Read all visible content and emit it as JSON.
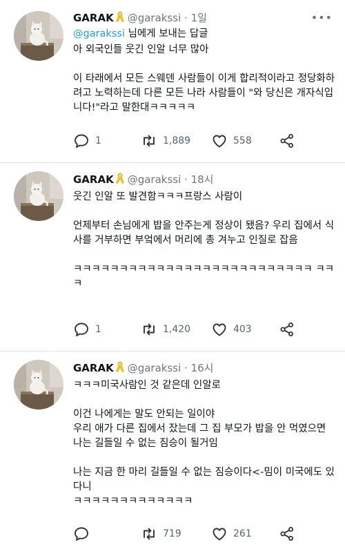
{
  "tweets": [
    {
      "name": "GARAK",
      "handle": "@garakssi",
      "time": "1일",
      "reply_to_handle": "@garakssi",
      "reply_to_suffix": " 님에게 보내는 답글",
      "paragraphs": [
        "아 외국인들 웃긴 인알 너무 많아",
        "",
        "이 타래에서 모든 스웨덴 사람들이 이게 합리적이라고 정당화하려고 노력하는데 다른 모든 나라 사람들이 \"와 당신은 개자식입니다!\"라고 말한대ㅋㅋㅋㅋㅋ"
      ],
      "replies": "1",
      "retweets": "1,889",
      "likes": "558",
      "more_icon": "more-dots-icon"
    },
    {
      "name": "GARAK",
      "handle": "@garakssi",
      "time": "18시",
      "paragraphs": [
        "웃긴 인알 또 발견함ㅋㅋㅋ프랑스 사람이",
        "",
        "언제부터 손님에게 밥을 안주는게 정상이 됐음? 우리 집에서 식사를 거부하면 부엌에서 머리에 총 겨누고 인질로 잡음",
        "",
        "ㅋㅋㅋㅋㅋㅋㅋㅋㅋㅋㅋㅋㅋㅋㅋㅋㅋㅋㅋㅋㅋㅋㅋㅋㅋㅋ ㅋㅋㅋ"
      ],
      "replies": "1",
      "retweets": "1,420",
      "likes": "403"
    },
    {
      "name": "GARAK",
      "handle": "@garakssi",
      "time": "16시",
      "paragraphs": [
        "ㅋㅋㅋ미국사람인 것 같은데 인알로",
        "",
        "이건 나에게는 말도 안되는 일이야",
        "우리 애가 다른 집에서 잤는데 그 집 부모가 밥을 안 먹였으면 나는 길들일 수 없는 짐승이 될거임",
        "",
        "나는 지금 한 마리 길들일 수 없는 짐승이다<-밈이 미국에도 있다니",
        "ㅋㅋㅋㅋㅋㅋㅋㅋㅋㅋㅋㅋㅋ"
      ],
      "replies": "",
      "retweets": "719",
      "likes": "261"
    }
  ],
  "colors": {
    "text": "#0f1419",
    "meta": "#6e767d",
    "mention": "#1d9bf0",
    "ribbon": "#f5c518"
  },
  "icons": {
    "reply": "reply-bubble-icon",
    "retweet": "retweet-icon",
    "like": "heart-icon",
    "share": "share-icon",
    "ribbon": "yellow-ribbon-icon"
  }
}
